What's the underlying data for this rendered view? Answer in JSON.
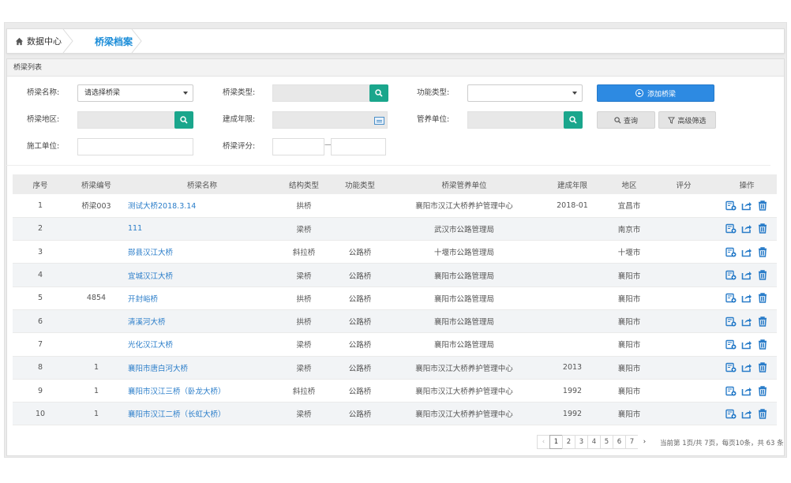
{
  "breadcrumb": {
    "home": "数据中心",
    "current": "桥梁档案"
  },
  "panel": {
    "title": "桥梁列表"
  },
  "filters": {
    "bridge_name_label": "桥梁名称:",
    "bridge_name_select": "请选择桥梁",
    "bridge_type_label": "桥梁类型:",
    "function_type_label": "功能类型:",
    "region_label": "桥梁地区:",
    "build_year_label": "建成年限:",
    "maint_unit_label": "管养单位:",
    "constr_unit_label": "施工单位:",
    "rating_label": "桥梁评分:",
    "rating_dash": "—"
  },
  "buttons": {
    "add": "添加桥梁",
    "query": "查询",
    "advanced": "高级筛选"
  },
  "table": {
    "headers": [
      "序号",
      "桥梁编号",
      "桥梁名称",
      "结构类型",
      "功能类型",
      "桥梁管养单位",
      "建成年限",
      "地区",
      "评分",
      "操作"
    ],
    "rows": [
      [
        "1",
        "桥梁003",
        "测试大桥2018.3.14",
        "拱桥",
        "",
        "襄阳市汉江大桥养护管理中心",
        "2018-01",
        "宜昌市",
        ""
      ],
      [
        "2",
        "",
        "111",
        "梁桥",
        "",
        "武汉市公路管理局",
        "",
        "南京市",
        ""
      ],
      [
        "3",
        "",
        "郧县汉江大桥",
        "斜拉桥",
        "公路桥",
        "十堰市公路管理局",
        "",
        "十堰市",
        ""
      ],
      [
        "4",
        "",
        "宜城汉江大桥",
        "梁桥",
        "公路桥",
        "襄阳市公路管理局",
        "",
        "襄阳市",
        ""
      ],
      [
        "5",
        "4854",
        "开封峪桥",
        "拱桥",
        "公路桥",
        "襄阳市公路管理局",
        "",
        "襄阳市",
        ""
      ],
      [
        "6",
        "",
        "清溪河大桥",
        "拱桥",
        "公路桥",
        "襄阳市公路管理局",
        "",
        "襄阳市",
        ""
      ],
      [
        "7",
        "",
        "光化汉江大桥",
        "梁桥",
        "公路桥",
        "襄阳市公路管理局",
        "",
        "襄阳市",
        ""
      ],
      [
        "8",
        "1",
        "襄阳市唐白河大桥",
        "梁桥",
        "公路桥",
        "襄阳市汉江大桥养护管理中心",
        "2013",
        "襄阳市",
        ""
      ],
      [
        "9",
        "1",
        "襄阳市汉江三桥（卧龙大桥）",
        "斜拉桥",
        "公路桥",
        "襄阳市汉江大桥养护管理中心",
        "1992",
        "襄阳市",
        ""
      ],
      [
        "10",
        "1",
        "襄阳市汉江二桥（长虹大桥）",
        "梁桥",
        "公路桥",
        "襄阳市汉江大桥养护管理中心",
        "1992",
        "襄阳市",
        ""
      ]
    ]
  },
  "pager": {
    "prev": "‹",
    "pages": [
      "1",
      "2",
      "3",
      "4",
      "5",
      "6",
      "7"
    ],
    "next": "›",
    "info": "当前第 1页/共 7页，每页10条，共 63 条"
  },
  "icons": {
    "edit": "edit-doc-icon",
    "share": "export-icon",
    "delete": "trash-icon",
    "search": "search-icon",
    "home": "home-icon"
  },
  "colors": {
    "primary": "#2d8ae2",
    "search_btn": "#1aa68c",
    "link": "#2a7dc9",
    "breadcrumb_active": "#1a8cd8"
  }
}
